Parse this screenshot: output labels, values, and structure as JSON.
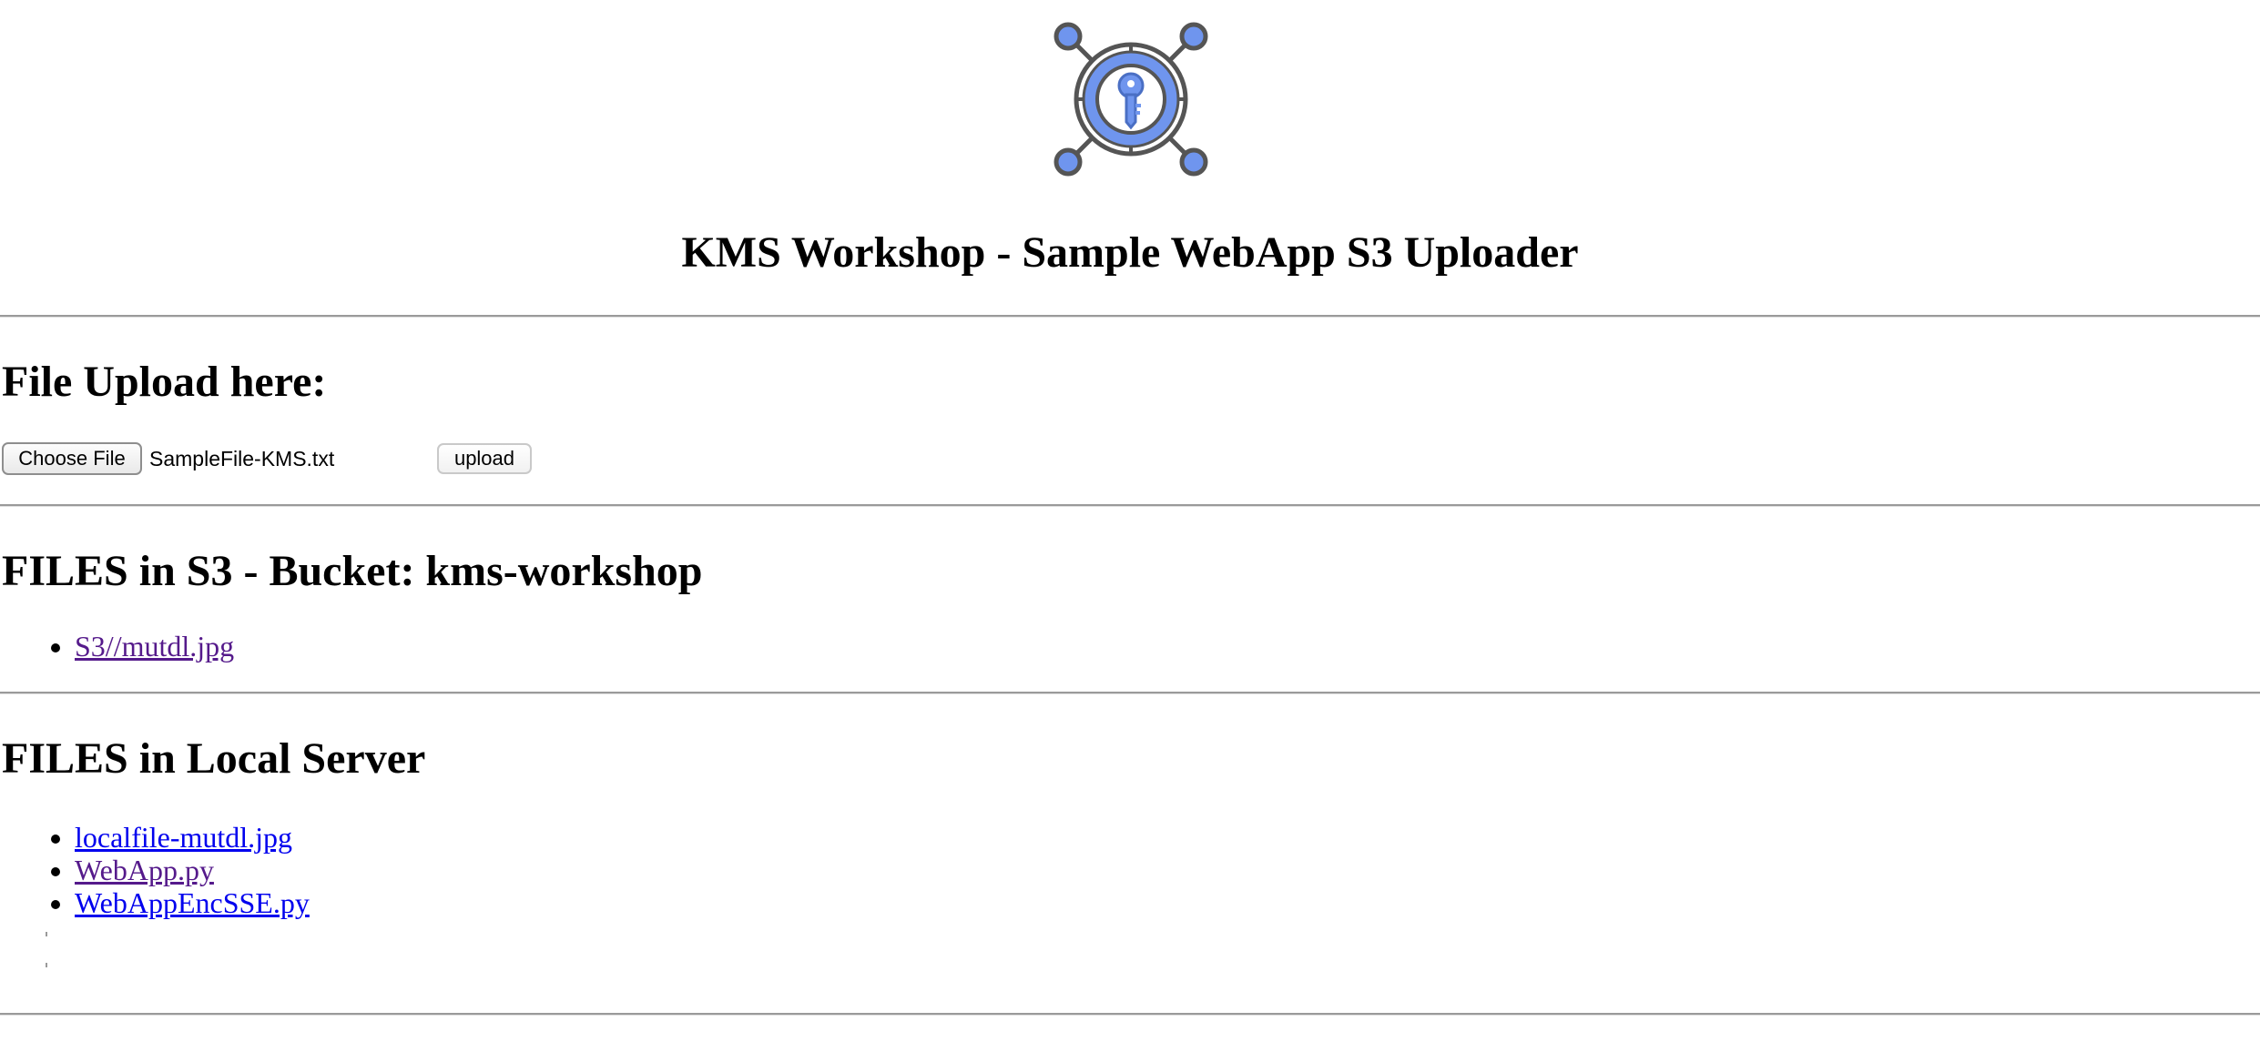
{
  "logo": {
    "icon": "kms-key-icon",
    "accent": "#6f95ee",
    "stroke": "#555555"
  },
  "page_title": "KMS Workshop - Sample WebApp S3 Uploader",
  "upload": {
    "heading": "File Upload here:",
    "choose_file_label": "Choose File",
    "selected_file": "SampleFile-KMS.txt",
    "upload_label": "upload"
  },
  "s3": {
    "heading": "FILES in S3 - Bucket: kms-workshop",
    "files": [
      "S3//mutdl.jpg"
    ]
  },
  "local": {
    "heading": "FILES in Local Server",
    "files": [
      "localfile-mutdl.jpg",
      "WebApp.py",
      "WebAppEncSSE.py"
    ]
  },
  "colors": {
    "link": "#0000ee",
    "visited_link": "#551a8b",
    "divider": "#9a9a9a"
  }
}
